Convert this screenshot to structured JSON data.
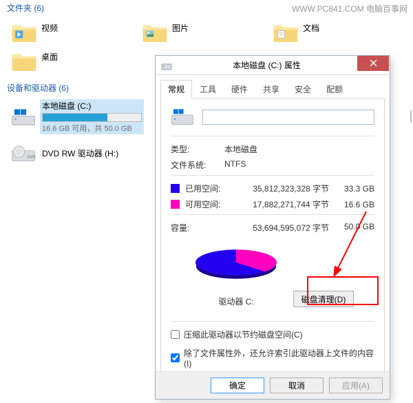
{
  "watermark": "WWW.PC841.COM 电脑百事网",
  "sections": {
    "folders_header": "文件夹 (6)",
    "devices_header": "设备和驱动器 (6)"
  },
  "folders": {
    "f0": "视频",
    "f1": "图片",
    "f2": "文档",
    "f3": "桌面"
  },
  "drive": {
    "name": "本地磁盘 (C:)",
    "bar_fill_pct": "66%",
    "subtext": "16.6 GB 可用，共 50.0 GB"
  },
  "dvd": {
    "name": "DVD RW 驱动器 (H:)"
  },
  "dialog": {
    "title": "本地磁盘 (C:) 属性",
    "tabs": {
      "general": "常规",
      "tools": "工具",
      "hardware": "硬件",
      "sharing": "共享",
      "security": "安全",
      "quota": "配额"
    },
    "general": {
      "name_value": "",
      "type_label": "类型:",
      "type_value": "本地磁盘",
      "fs_label": "文件系统:",
      "fs_value": "NTFS",
      "used_label": "已用空间:",
      "used_bytes": "35,812,323,328 字节",
      "used_hr": "33.3 GB",
      "free_label": "可用空间:",
      "free_bytes": "17,882,271,744 字节",
      "free_hr": "16.6 GB",
      "capacity_label": "容量:",
      "capacity_bytes": "53,694,595,072 字节",
      "capacity_hr": "50.0 GB",
      "drive_label": "驱动器 C:",
      "cleanup_btn": "磁盘清理(D)",
      "chk_compress": "压缩此驱动器以节约磁盘空间(C)",
      "chk_index": "除了文件属性外，还允许索引此驱动器上文件的内容(I)"
    },
    "buttons": {
      "ok": "确定",
      "cancel": "取消",
      "apply": "应用(A)"
    }
  },
  "chart_data": {
    "type": "pie",
    "title": "驱动器 C:",
    "categories": [
      "已用空间",
      "可用空间"
    ],
    "values": [
      33.3,
      16.6
    ],
    "unit": "GB",
    "colors": [
      "#2200ef",
      "#ff00c1"
    ]
  }
}
